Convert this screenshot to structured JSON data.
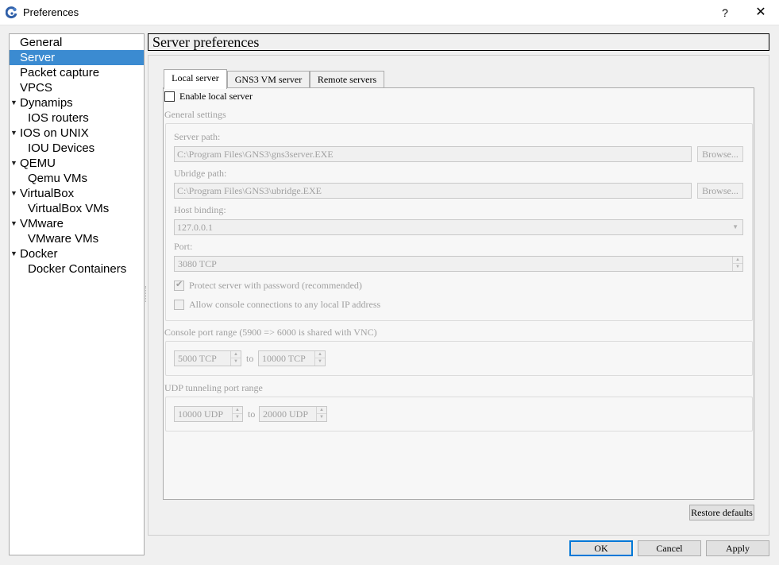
{
  "window": {
    "title": "Preferences",
    "help": "?",
    "close": "✕"
  },
  "sidebar": {
    "items": [
      {
        "label": "General"
      },
      {
        "label": "Server"
      },
      {
        "label": "Packet capture"
      },
      {
        "label": "VPCS"
      },
      {
        "label": "Dynamips"
      },
      {
        "label": "IOS routers"
      },
      {
        "label": "IOS on UNIX"
      },
      {
        "label": "IOU Devices"
      },
      {
        "label": "QEMU"
      },
      {
        "label": "Qemu VMs"
      },
      {
        "label": "VirtualBox"
      },
      {
        "label": "VirtualBox VMs"
      },
      {
        "label": "VMware"
      },
      {
        "label": "VMware VMs"
      },
      {
        "label": "Docker"
      },
      {
        "label": "Docker Containers"
      }
    ],
    "selected": "Server"
  },
  "page": {
    "title": "Server preferences"
  },
  "tabs": [
    {
      "label": "Local server"
    },
    {
      "label": "GNS3 VM server"
    },
    {
      "label": "Remote servers"
    }
  ],
  "local_server": {
    "enable_label": "Enable local server",
    "enable_checked": false,
    "general_settings_label": "General settings",
    "server_path_label": "Server path:",
    "server_path_value": "C:\\Program Files\\GNS3\\gns3server.EXE",
    "browse_label": "Browse...",
    "ubridge_path_label": "Ubridge path:",
    "ubridge_path_value": "C:\\Program Files\\GNS3\\ubridge.EXE",
    "host_binding_label": "Host binding:",
    "host_binding_value": "127.0.0.1",
    "port_label": "Port:",
    "port_value": "3080 TCP",
    "protect_label": "Protect server with password (recommended)",
    "protect_checked": true,
    "allow_console_label": "Allow console connections to any local IP address",
    "allow_console_checked": false,
    "console_range_label": "Console port range (5900 => 6000 is shared with VNC)",
    "console_start": "5000 TCP",
    "console_end": "10000 TCP",
    "to_label": "to",
    "udp_range_label": "UDP tunneling port range",
    "udp_start": "10000 UDP",
    "udp_end": "20000 UDP"
  },
  "buttons": {
    "restore_defaults": "Restore defaults",
    "ok": "OK",
    "cancel": "Cancel",
    "apply": "Apply"
  },
  "icons": {
    "app": "gns3-app-icon",
    "tree_expand": "▼",
    "spin_up": "▲",
    "spin_down": "▼",
    "dropdown": "▼",
    "checkmark": "✔"
  },
  "colors": {
    "selection": "#3b8bd1",
    "default_button_border": "#0078d7"
  }
}
